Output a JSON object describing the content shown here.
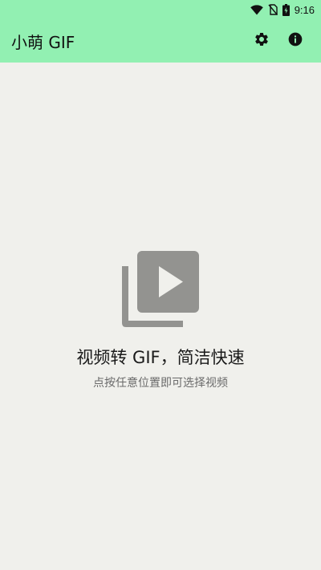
{
  "status_bar": {
    "time": "9:16",
    "icons": [
      "wifi-icon",
      "no-sim-icon",
      "battery-icon"
    ]
  },
  "app_bar": {
    "title": "小萌 GIF",
    "background": "#92f0b2",
    "actions": [
      {
        "name": "settings",
        "icon": "gear-icon"
      },
      {
        "name": "info",
        "icon": "info-icon"
      }
    ]
  },
  "main": {
    "background": "#f0f0ec",
    "icon": "video-library-icon",
    "icon_color": "#939390",
    "title": "视频转 GIF，简洁快速",
    "subtitle": "点按任意位置即可选择视频"
  }
}
